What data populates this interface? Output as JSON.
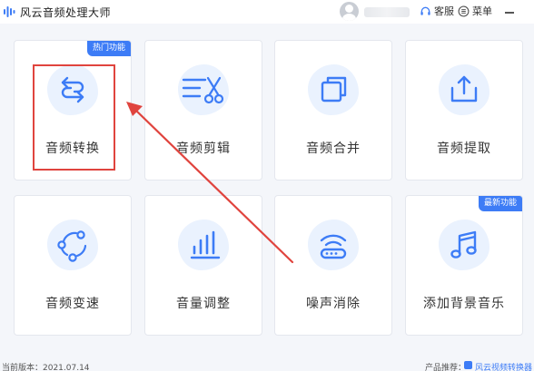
{
  "titlebar": {
    "app_title": "风云音频处理大师",
    "service_label": "客服",
    "menu_label": "菜单"
  },
  "cards": [
    {
      "label": "音频转换",
      "badge": "热门功能",
      "icon": "convert-arrows-icon"
    },
    {
      "label": "音频剪辑",
      "icon": "scissors-icon"
    },
    {
      "label": "音频合并",
      "icon": "merge-squares-icon"
    },
    {
      "label": "音频提取",
      "icon": "extract-upload-icon"
    },
    {
      "label": "音频变速",
      "icon": "speed-cycle-icon"
    },
    {
      "label": "音量调整",
      "icon": "volume-bars-icon"
    },
    {
      "label": "噪声消除",
      "icon": "noise-wifi-icon"
    },
    {
      "label": "添加背景音乐",
      "badge": "最新功能",
      "icon": "music-note-icon"
    }
  ],
  "statusbar": {
    "version": "当前版本：2021.07.14",
    "recommend": "产品推荐：",
    "product": "风云视频转换器"
  },
  "colors": {
    "accent": "#3d7cf6",
    "highlight": "#e0443e",
    "icon_bg": "#eaf2fe"
  }
}
